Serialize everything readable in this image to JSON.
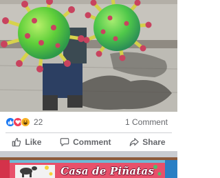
{
  "post": {
    "reaction_types": [
      "like",
      "love",
      "haha"
    ],
    "reaction_count": "22",
    "comment_count": "1 Comment",
    "actions": {
      "like_label": "Like",
      "comment_label": "Comment",
      "share_label": "Share"
    }
  },
  "next_post": {
    "banner_title": "Casa de Piñatas"
  },
  "colors": {
    "like_blue": "#1877f2",
    "love_red": "#f33e58",
    "haha_yellow": "#f7b125",
    "meta_text": "#65676b",
    "divider": "#ced0d4",
    "feed_gap": "#c9ccd1"
  }
}
